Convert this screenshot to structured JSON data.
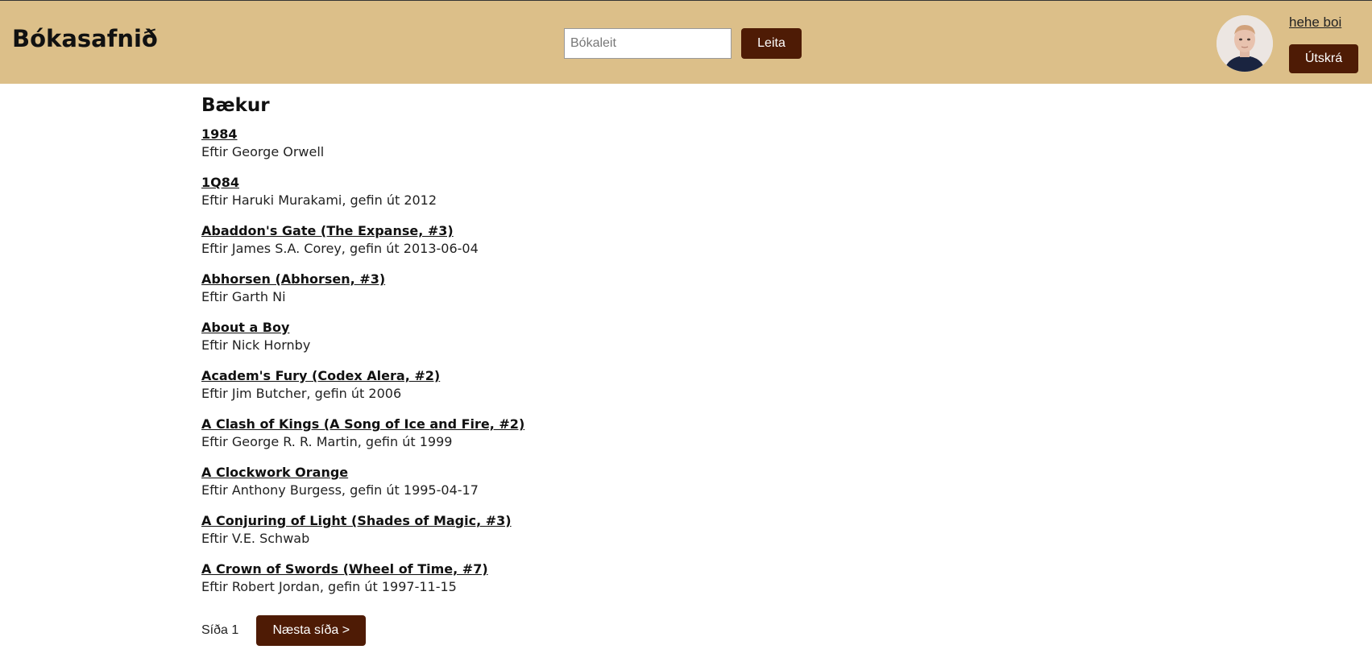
{
  "header": {
    "brand": "Bókasafnið",
    "search": {
      "placeholder": "Bókaleit",
      "value": "",
      "button_label": "Leita"
    },
    "user": {
      "name": "hehe boi",
      "logout_label": "Útskrá"
    }
  },
  "main": {
    "title": "Bækur",
    "books": [
      {
        "title": "1984",
        "meta": "Eftir George Orwell"
      },
      {
        "title": "1Q84",
        "meta": "Eftir Haruki Murakami, gefin út 2012"
      },
      {
        "title": "Abaddon's Gate (The Expanse, #3)",
        "meta": "Eftir James S.A. Corey, gefin út 2013-06-04"
      },
      {
        "title": "Abhorsen (Abhorsen, #3)",
        "meta": "Eftir Garth Ni"
      },
      {
        "title": "About a Boy",
        "meta": "Eftir Nick Hornby"
      },
      {
        "title": "Academ's Fury (Codex Alera, #2)",
        "meta": "Eftir Jim Butcher, gefin út 2006"
      },
      {
        "title": "A Clash of Kings (A Song of Ice and Fire, #2)",
        "meta": "Eftir George R. R. Martin, gefin út 1999"
      },
      {
        "title": "A Clockwork Orange",
        "meta": "Eftir Anthony Burgess, gefin út 1995-04-17"
      },
      {
        "title": "A Conjuring of Light (Shades of Magic, #3)",
        "meta": "Eftir V.E. Schwab"
      },
      {
        "title": "A Crown of Swords (Wheel of Time, #7)",
        "meta": "Eftir Robert Jordan, gefin út 1997-11-15"
      }
    ],
    "pager": {
      "page_label": "Síða 1",
      "next_label": "Næsta síða >"
    }
  },
  "colors": {
    "header_bg": "#dcbf89",
    "button_bg": "#4e1b05"
  }
}
